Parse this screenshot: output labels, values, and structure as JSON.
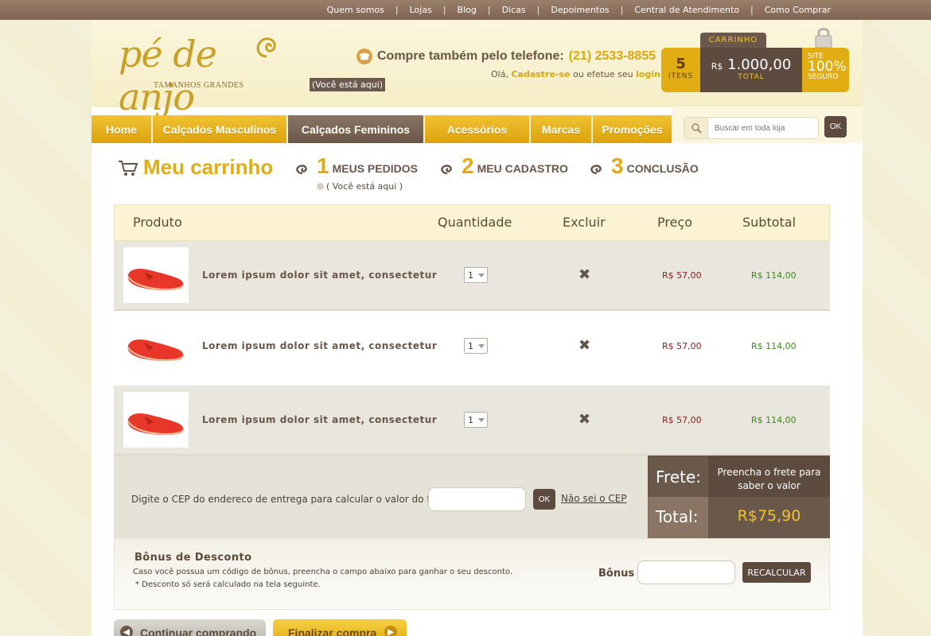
{
  "toplinks": [
    "Quem somos",
    "Lojas",
    "Blog",
    "Dicas",
    "Depoimentos",
    "Central de Atendimento",
    "Como Comprar"
  ],
  "logo": {
    "word": "pé de anjo",
    "sub": "TAMANHOS GRANDES"
  },
  "here_tag": "(Você está aqui)",
  "phone": {
    "label": "Compre também pelo telefone:",
    "number": "(21) 2533-8855"
  },
  "hello": {
    "prefix": "Olá,",
    "register": "Cadastre-se",
    "middle": "ou efetue seu",
    "login": "login"
  },
  "cart": {
    "tab": "CARRINHO",
    "count": "5",
    "count_label": "ITENS",
    "currency": "R$",
    "total": "1.000,00",
    "total_label": "TOTAL",
    "secure_a": "SITE",
    "secure_b": "100%",
    "secure_c": "SEGURO"
  },
  "nav": [
    "Home",
    "Calçados Masculinos",
    "Calçados Femininos",
    "Acessórios",
    "Marcas",
    "Promoções"
  ],
  "search": {
    "placeholder": "Buscar em toda loja",
    "button": "OK"
  },
  "steps": {
    "title": "Meu carrinho",
    "s1_num": "1",
    "s1_label": "MEUS PEDIDOS",
    "s2_num": "2",
    "s2_label": "MEU CADASTRO",
    "s3_num": "3",
    "s3_label": "CONCLUSÃO",
    "here": "( Você está aqui )"
  },
  "table": {
    "headers": {
      "product": "Produto",
      "qty": "Quantidade",
      "del": "Excluir",
      "price": "Preço",
      "sub": "Subtotal"
    },
    "rows": [
      {
        "name": "Lorem ipsum dolor sit amet, consectetur",
        "qty": "1",
        "price": "R$ 57,00",
        "subtotal": "R$ 114,00"
      },
      {
        "name": "Lorem ipsum dolor sit amet, consectetur",
        "qty": "1",
        "price": "R$ 57,00",
        "subtotal": "R$ 114,00"
      },
      {
        "name": "Lorem ipsum dolor sit amet, consectetur",
        "qty": "1",
        "price": "R$ 57,00",
        "subtotal": "R$ 114,00"
      }
    ]
  },
  "frete": {
    "label": "Digite o CEP do endereco de entrega para calcular o valor do frete:",
    "ok": "OK",
    "dunno": "Não sei o CEP",
    "frete_label": "Frete:",
    "frete_value": "Preencha o frete para saber o valor",
    "total_label": "Total:",
    "total_value": "R$75,90"
  },
  "bonus": {
    "title": "Bônus de Desconto",
    "desc1": "Caso você possua um código de bônus, preencha o campo abaixo para ganhar o seu desconto.",
    "desc2": "* Desconto só será calculado na tela seguinte.",
    "label": "Bônus",
    "button": "RECALCULAR"
  },
  "buttons": {
    "continue": "Continuar comprando",
    "finish": "Finalizar compra"
  },
  "colors": {
    "gold": "#e1ad12",
    "brown": "#5d4b40",
    "price": "#8b1c1c",
    "subtotal": "#3c8a1c"
  }
}
